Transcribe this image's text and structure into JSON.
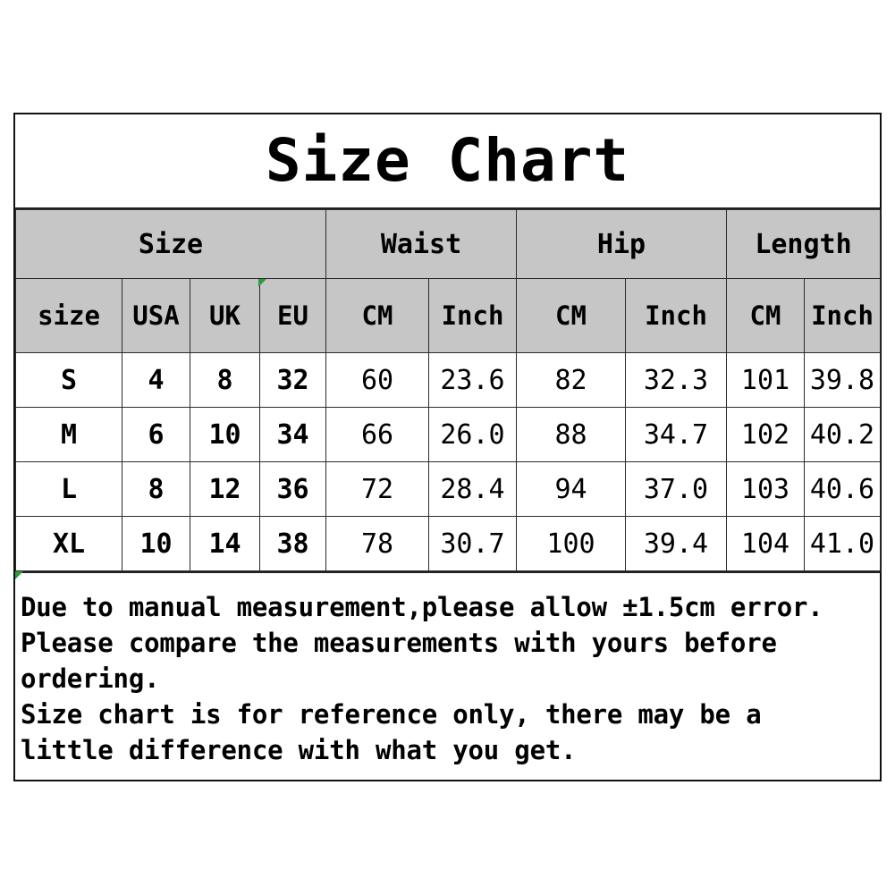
{
  "title": "Size Chart",
  "colors": {
    "header_fill": "#c6c6c6",
    "body_fill": "#ffffff",
    "border": "#2b2b2b",
    "text": "#000000",
    "accent_mark": "#2e9b3e"
  },
  "chart_data": {
    "type": "table",
    "title": "Size Chart",
    "group_headers": [
      {
        "label": "Size",
        "span": 4
      },
      {
        "label": "Waist",
        "span": 2
      },
      {
        "label": "Hip",
        "span": 2
      },
      {
        "label": "Length",
        "span": 2
      }
    ],
    "columns": [
      "size",
      "USA",
      "UK",
      "EU",
      "CM",
      "Inch",
      "CM",
      "Inch",
      "CM",
      "Inch"
    ],
    "rows": [
      [
        "S",
        "4",
        "8",
        "32",
        "60",
        "23.6",
        "82",
        "32.3",
        "101",
        "39.8"
      ],
      [
        "M",
        "6",
        "10",
        "34",
        "66",
        "26.0",
        "88",
        "34.7",
        "102",
        "40.2"
      ],
      [
        "L",
        "8",
        "12",
        "36",
        "72",
        "28.4",
        "94",
        "37.0",
        "103",
        "40.6"
      ],
      [
        "XL",
        "10",
        "14",
        "38",
        "78",
        "30.7",
        "100",
        "39.4",
        "104",
        "41.0"
      ]
    ]
  },
  "notes": [
    "Due to manual measurement,please allow ±1.5cm error.",
    "Please compare the measurements with yours before",
    "ordering.",
    "Size chart is for reference only, there may be a",
    "little difference with what you get."
  ]
}
